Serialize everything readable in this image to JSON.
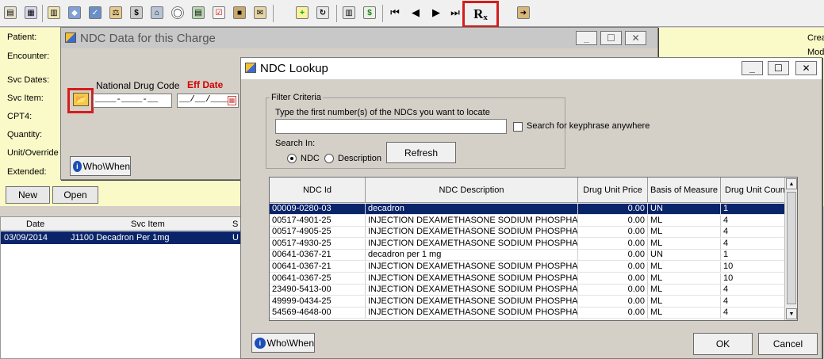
{
  "toolbar": {
    "icons": [
      "document-icon",
      "calendar-icon",
      "table-icon",
      "shield-icon",
      "shield-check-icon",
      "scales-icon",
      "people-dollar-icon",
      "bank-icon",
      "globe-icon",
      "grid-icon",
      "checklist-icon",
      "box-icon",
      "letter-icon",
      "recycle-icon",
      "spreadsheet-icon",
      "dollar-icon",
      "first-icon",
      "prev-icon",
      "next-icon",
      "last-icon",
      "rx-icon",
      "exit-icon"
    ],
    "rx_label": "R",
    "rx_sub": "x",
    "highlight_color": "#d61c1c"
  },
  "background_form": {
    "labels": {
      "patient": "Patient:",
      "encounter": "Encounter:",
      "svc_dates": "Svc Dates:",
      "svc_item": "Svc Item:",
      "cpt4": "CPT4:",
      "quantity": "Quantity:",
      "unit_override": "Unit/Override",
      "extended": "Extended:"
    },
    "right_labels": {
      "created": "Crea",
      "modified": "Mod"
    },
    "new_button": "New",
    "open_button": "Open",
    "list": {
      "columns": [
        "Date",
        "Svc Item",
        "S"
      ],
      "rows": [
        {
          "date": "03/09/2014",
          "svc_item": "J1100 Decadron Per 1mg",
          "status": "U"
        }
      ]
    },
    "bg_color": "#fafac8"
  },
  "ndc_data_dialog": {
    "title": "NDC Data for this Charge",
    "national_drug_code_label": "National Drug Code",
    "eff_date_label": "Eff Date",
    "ndc_mask": "____-____-__",
    "date_mask": "__/__/____",
    "who_when": "Who\\When",
    "min": "_",
    "max": "☐",
    "close": "✕"
  },
  "ndc_lookup": {
    "title": "NDC Lookup",
    "filter_criteria": "Filter Criteria",
    "type_prompt": "Type the first number(s) of the NDCs you want to locate",
    "search_value": "",
    "keyphrase_label": "Search for keyphrase anywhere",
    "search_in": "Search In:",
    "radio_ndc": "NDC",
    "radio_description": "Description",
    "refresh": "Refresh",
    "who_when": "Who\\When",
    "ok": "OK",
    "cancel": "Cancel",
    "min": "_",
    "max": "☐",
    "close": "✕",
    "columns": [
      "NDC Id",
      "NDC Description",
      "Drug Unit Price",
      "Basis of Measure",
      "Drug Unit Count"
    ],
    "rows": [
      {
        "ndc": "00009-0280-03",
        "desc": "decadron",
        "price": "0.00",
        "basis": "UN",
        "count": "1",
        "selected": true
      },
      {
        "ndc": "00517-4901-25",
        "desc": "INJECTION DEXAMETHASONE SODIUM PHOSPHAT",
        "price": "0.00",
        "basis": "ML",
        "count": "4"
      },
      {
        "ndc": "00517-4905-25",
        "desc": "INJECTION DEXAMETHASONE SODIUM PHOSPHAT",
        "price": "0.00",
        "basis": "ML",
        "count": "4"
      },
      {
        "ndc": "00517-4930-25",
        "desc": "INJECTION DEXAMETHASONE SODIUM PHOSPHAT",
        "price": "0.00",
        "basis": "ML",
        "count": "4"
      },
      {
        "ndc": "00641-0367-21",
        "desc": "decadron per 1 mg",
        "price": "0.00",
        "basis": "UN",
        "count": "1"
      },
      {
        "ndc": "00641-0367-21",
        "desc": "INJECTION DEXAMETHASONE SODIUM PHOSPHAT",
        "price": "0.00",
        "basis": "ML",
        "count": "10"
      },
      {
        "ndc": "00641-0367-25",
        "desc": "INJECTION DEXAMETHASONE SODIUM PHOSPHAT",
        "price": "0.00",
        "basis": "ML",
        "count": "10"
      },
      {
        "ndc": "23490-5413-00",
        "desc": "INJECTION DEXAMETHASONE SODIUM PHOSPHAT",
        "price": "0.00",
        "basis": "ML",
        "count": "4"
      },
      {
        "ndc": "49999-0434-25",
        "desc": "INJECTION DEXAMETHASONE SODIUM PHOSPHAT",
        "price": "0.00",
        "basis": "ML",
        "count": "4"
      },
      {
        "ndc": "54569-4648-00",
        "desc": "INJECTION DEXAMETHASONE SODIUM PHOSPHAT",
        "price": "0.00",
        "basis": "ML",
        "count": "4"
      }
    ],
    "selection_color": "#0a246a"
  }
}
